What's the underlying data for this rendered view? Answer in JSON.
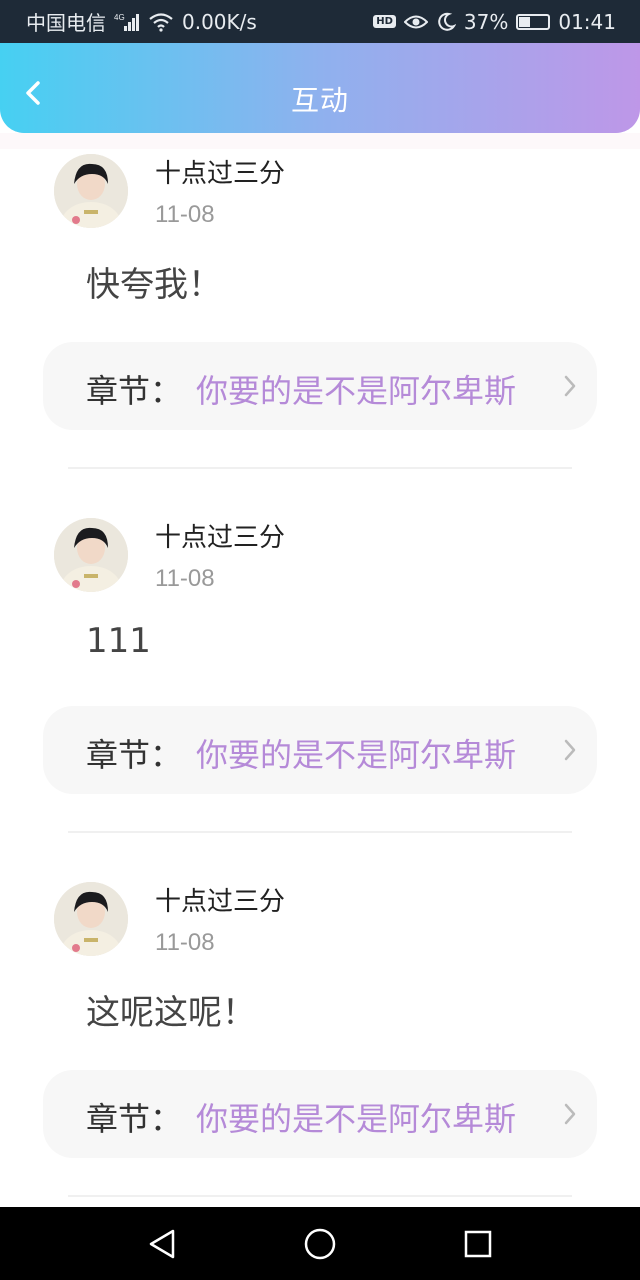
{
  "status_bar": {
    "carrier": "中国电信",
    "network": "4G",
    "speed": "0.00K/s",
    "hd": "HD",
    "battery_percent": "37%",
    "battery_level": 0.37,
    "time": "01:41",
    "icons": [
      "signal-icon",
      "wifi-icon",
      "hd-icon",
      "eye-icon",
      "moon-icon",
      "battery-icon"
    ]
  },
  "header": {
    "title": "互动",
    "back_icon": "chevron-left-icon",
    "gradient": [
      "#46d0f2",
      "#8fb1ee",
      "#be97e8"
    ]
  },
  "posts": [
    {
      "username": "十点过三分",
      "date": "11-08",
      "content": "快夸我！",
      "chapter_label": "章节：",
      "chapter_title": "你要的是不是阿尔卑斯"
    },
    {
      "username": "十点过三分",
      "date": "11-08",
      "content": "111",
      "chapter_label": "章节：",
      "chapter_title": "你要的是不是阿尔卑斯"
    },
    {
      "username": "十点过三分",
      "date": "11-08",
      "content": "这呢这呢！",
      "chapter_label": "章节：",
      "chapter_title": "你要的是不是阿尔卑斯"
    }
  ],
  "colors": {
    "accent": "#b58ad8",
    "chapter_bg": "#f7f7f7",
    "status_bar_bg": "#1e2a37"
  },
  "nav_bar": {
    "icons": [
      "back-triangle-icon",
      "home-circle-icon",
      "recent-square-icon"
    ]
  }
}
